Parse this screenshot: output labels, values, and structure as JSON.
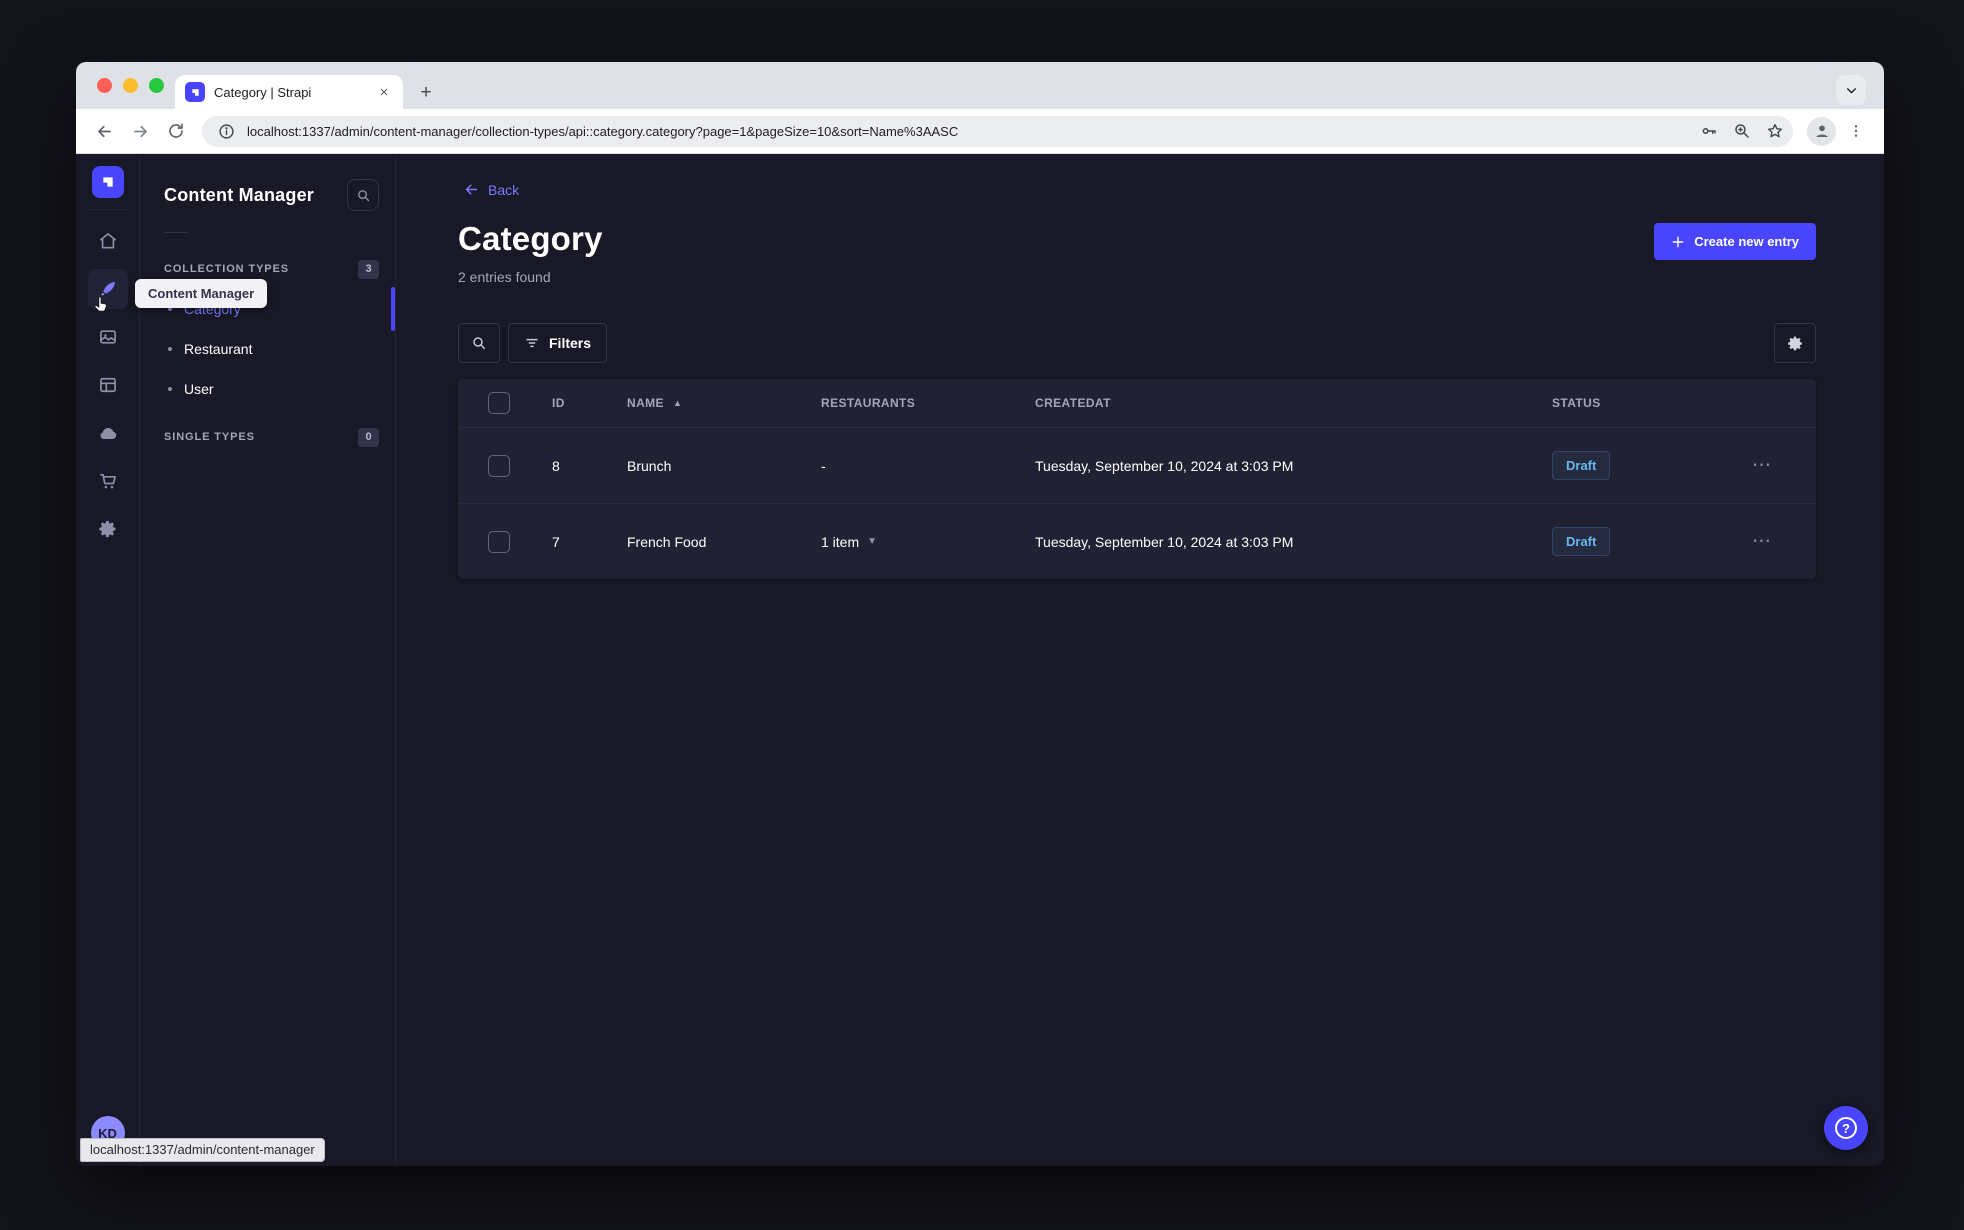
{
  "browser": {
    "tab_title": "Category | Strapi",
    "close_glyph": "×",
    "new_tab_glyph": "+",
    "url": "localhost:1337/admin/content-manager/collection-types/api::category.category?page=1&pageSize=10&sort=Name%3AASC",
    "status_bar_url": "localhost:1337/admin/content-manager",
    "traffic_lights": {
      "close": "#ff5f57",
      "minimize": "#febc2e",
      "zoom": "#28c840"
    }
  },
  "rail": {
    "tooltip": "Content Manager",
    "avatar_initials": "KD",
    "icons": [
      "strapi-logo",
      "home-icon",
      "content-manager-icon",
      "media-library-icon",
      "content-type-builder-icon",
      "cloud-icon",
      "marketplace-icon",
      "settings-icon"
    ]
  },
  "subnav": {
    "title": "Content Manager",
    "collection_types": {
      "label": "COLLECTION TYPES",
      "badge": "3",
      "items": [
        {
          "label": "Category",
          "active": true
        },
        {
          "label": "Restaurant",
          "active": false
        },
        {
          "label": "User",
          "active": false
        }
      ]
    },
    "single_types": {
      "label": "SINGLE TYPES",
      "badge": "0"
    }
  },
  "main": {
    "back_label": "Back",
    "title": "Category",
    "subtitle": "2 entries found",
    "create_button_label": "Create new entry",
    "filters_button_label": "Filters",
    "table": {
      "headers": {
        "id": "ID",
        "name": "NAME",
        "restaurants": "RESTAURANTS",
        "createdat": "CREATEDAT",
        "status": "STATUS"
      },
      "sort_column": "NAME",
      "sort_direction": "ASC",
      "rows": [
        {
          "id": "8",
          "name": "Brunch",
          "restaurants": "-",
          "createdat": "Tuesday, September 10, 2024 at 3:03 PM",
          "status": "Draft"
        },
        {
          "id": "7",
          "name": "French Food",
          "restaurants": "1 item",
          "createdat": "Tuesday, September 10, 2024 at 3:03 PM",
          "status": "Draft"
        }
      ]
    }
  },
  "colors": {
    "primary": "#4945ff",
    "primary_light": "#7b79ff",
    "page_bg": "#181826",
    "card_bg": "#212134",
    "border": "#32324d",
    "muted_text": "#a5a5ba",
    "draft_text": "#66b7f1"
  }
}
